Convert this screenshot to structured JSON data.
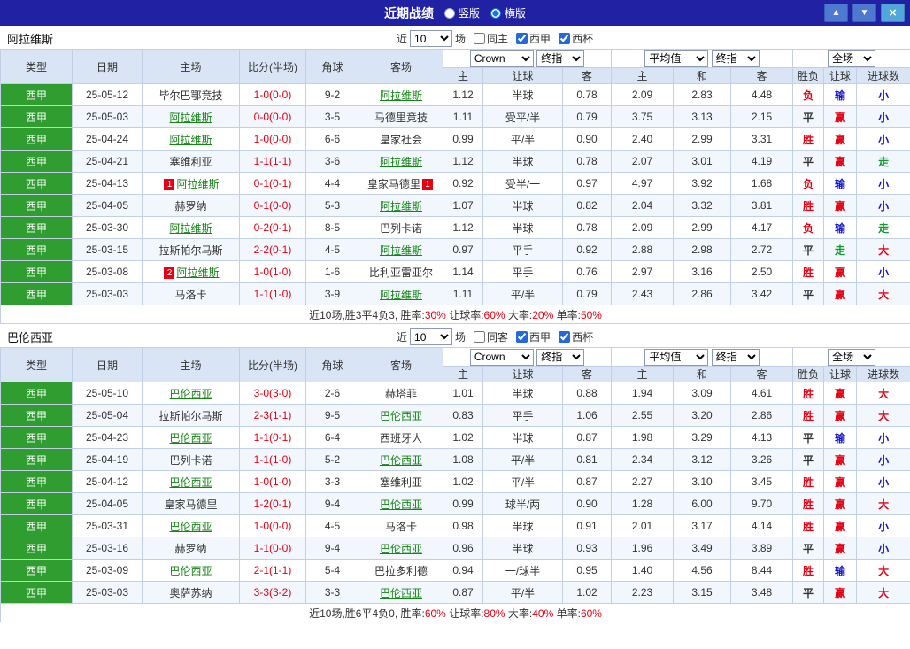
{
  "topbar": {
    "title": "近期战绩",
    "radios": [
      {
        "label": "竖版",
        "selected": false
      },
      {
        "label": "横版",
        "selected": true
      }
    ],
    "icons": {
      "up": "▲",
      "down": "▼",
      "close": "×"
    }
  },
  "colors": {
    "accent_green": "#2f9d2f",
    "win_red": "#e60012",
    "lose_blue": "#1414c8",
    "push_green": "#0f9a30",
    "header_blue": "#d9e5f4",
    "topbar_blue": "#2121a3"
  },
  "columns": [
    "类型",
    "日期",
    "主场",
    "比分(半场)",
    "角球",
    "客场",
    "主",
    "让球",
    "客",
    "主",
    "和",
    "客",
    "胜负",
    "让球",
    "进球数"
  ],
  "sections": [
    {
      "team": "阿拉维斯",
      "near_label": "近",
      "games_count": "10",
      "games_unit": "场",
      "checkboxes": [
        {
          "label": "同主",
          "checked": false
        },
        {
          "label": "西甲",
          "checked": true
        },
        {
          "label": "西杯",
          "checked": true
        }
      ],
      "filters": {
        "bookmaker": "Crown",
        "asia_stage": "终指",
        "euro_source": "平均值",
        "euro_stage": "终指",
        "scope": "全场"
      },
      "rows": [
        {
          "league": "西甲",
          "date": "25-05-12",
          "home": "毕尔巴鄂竞技",
          "home_focus": false,
          "score": "1-0(0-0)",
          "corner": "9-2",
          "away": "阿拉维斯",
          "away_focus": true,
          "asia_home": "1.12",
          "asia_line": "半球",
          "asia_away": "0.78",
          "euro_home": "2.09",
          "euro_draw": "2.83",
          "euro_away": "4.48",
          "result": "负",
          "handicap_result": "输",
          "goals": "小"
        },
        {
          "league": "西甲",
          "date": "25-05-03",
          "home": "阿拉维斯",
          "home_focus": true,
          "score": "0-0(0-0)",
          "corner": "3-5",
          "away": "马德里竞技",
          "away_focus": false,
          "asia_home": "1.11",
          "asia_line": "受平/半",
          "asia_away": "0.79",
          "euro_home": "3.75",
          "euro_draw": "3.13",
          "euro_away": "2.15",
          "result": "平",
          "handicap_result": "赢",
          "goals": "小"
        },
        {
          "league": "西甲",
          "date": "25-04-24",
          "home": "阿拉维斯",
          "home_focus": true,
          "score": "1-0(0-0)",
          "corner": "6-6",
          "away": "皇家社会",
          "away_focus": false,
          "asia_home": "0.99",
          "asia_line": "平/半",
          "asia_away": "0.90",
          "euro_home": "2.40",
          "euro_draw": "2.99",
          "euro_away": "3.31",
          "result": "胜",
          "handicap_result": "赢",
          "goals": "小"
        },
        {
          "league": "西甲",
          "date": "25-04-21",
          "home": "塞维利亚",
          "home_focus": false,
          "score": "1-1(1-1)",
          "corner": "3-6",
          "away": "阿拉维斯",
          "away_focus": true,
          "asia_home": "1.12",
          "asia_line": "半球",
          "asia_away": "0.78",
          "euro_home": "2.07",
          "euro_draw": "3.01",
          "euro_away": "4.19",
          "result": "平",
          "handicap_result": "赢",
          "goals": "走"
        },
        {
          "league": "西甲",
          "date": "25-04-13",
          "home": "阿拉维斯",
          "home_focus": true,
          "home_badge": "1",
          "score": "0-1(0-1)",
          "corner": "4-4",
          "away": "皇家马德里",
          "away_focus": false,
          "away_badge": "1",
          "asia_home": "0.92",
          "asia_line": "受半/一",
          "asia_away": "0.97",
          "euro_home": "4.97",
          "euro_draw": "3.92",
          "euro_away": "1.68",
          "result": "负",
          "handicap_result": "输",
          "goals": "小"
        },
        {
          "league": "西甲",
          "date": "25-04-05",
          "home": "赫罗纳",
          "home_focus": false,
          "score": "0-1(0-0)",
          "corner": "5-3",
          "away": "阿拉维斯",
          "away_focus": true,
          "asia_home": "1.07",
          "asia_line": "半球",
          "asia_away": "0.82",
          "euro_home": "2.04",
          "euro_draw": "3.32",
          "euro_away": "3.81",
          "result": "胜",
          "handicap_result": "赢",
          "goals": "小"
        },
        {
          "league": "西甲",
          "date": "25-03-30",
          "home": "阿拉维斯",
          "home_focus": true,
          "score": "0-2(0-1)",
          "corner": "8-5",
          "away": "巴列卡诺",
          "away_focus": false,
          "asia_home": "1.12",
          "asia_line": "半球",
          "asia_away": "0.78",
          "euro_home": "2.09",
          "euro_draw": "2.99",
          "euro_away": "4.17",
          "result": "负",
          "handicap_result": "输",
          "goals": "走"
        },
        {
          "league": "西甲",
          "date": "25-03-15",
          "home": "拉斯帕尔马斯",
          "home_focus": false,
          "score": "2-2(0-1)",
          "corner": "4-5",
          "away": "阿拉维斯",
          "away_focus": true,
          "asia_home": "0.97",
          "asia_line": "平手",
          "asia_away": "0.92",
          "euro_home": "2.88",
          "euro_draw": "2.98",
          "euro_away": "2.72",
          "result": "平",
          "handicap_result": "走",
          "goals": "大"
        },
        {
          "league": "西甲",
          "date": "25-03-08",
          "home": "阿拉维斯",
          "home_focus": true,
          "home_badge": "2",
          "score": "1-0(1-0)",
          "corner": "1-6",
          "away": "比利亚雷亚尔",
          "away_focus": false,
          "asia_home": "1.14",
          "asia_line": "平手",
          "asia_away": "0.76",
          "euro_home": "2.97",
          "euro_draw": "3.16",
          "euro_away": "2.50",
          "result": "胜",
          "handicap_result": "赢",
          "goals": "小"
        },
        {
          "league": "西甲",
          "date": "25-03-03",
          "home": "马洛卡",
          "home_focus": false,
          "score": "1-1(1-0)",
          "corner": "3-9",
          "away": "阿拉维斯",
          "away_focus": true,
          "asia_home": "1.11",
          "asia_line": "平/半",
          "asia_away": "0.79",
          "euro_home": "2.43",
          "euro_draw": "2.86",
          "euro_away": "3.42",
          "result": "平",
          "handicap_result": "赢",
          "goals": "大"
        }
      ],
      "summary": {
        "prefix": "近10场,胜3平4负3,",
        "stats": [
          {
            "label": "胜率:",
            "value": "30%"
          },
          {
            "label": "让球率:",
            "value": "60%"
          },
          {
            "label": "大率:",
            "value": "20%"
          },
          {
            "label": "单率:",
            "value": "50%"
          }
        ]
      }
    },
    {
      "team": "巴伦西亚",
      "near_label": "近",
      "games_count": "10",
      "games_unit": "场",
      "checkboxes": [
        {
          "label": "同客",
          "checked": false
        },
        {
          "label": "西甲",
          "checked": true
        },
        {
          "label": "西杯",
          "checked": true
        }
      ],
      "filters": {
        "bookmaker": "Crown",
        "asia_stage": "终指",
        "euro_source": "平均值",
        "euro_stage": "终指",
        "scope": "全场"
      },
      "rows": [
        {
          "league": "西甲",
          "date": "25-05-10",
          "home": "巴伦西亚",
          "home_focus": true,
          "score": "3-0(3-0)",
          "corner": "2-6",
          "away": "赫塔菲",
          "away_focus": false,
          "asia_home": "1.01",
          "asia_line": "半球",
          "asia_away": "0.88",
          "euro_home": "1.94",
          "euro_draw": "3.09",
          "euro_away": "4.61",
          "result": "胜",
          "handicap_result": "赢",
          "goals": "大"
        },
        {
          "league": "西甲",
          "date": "25-05-04",
          "home": "拉斯帕尔马斯",
          "home_focus": false,
          "score": "2-3(1-1)",
          "corner": "9-5",
          "away": "巴伦西亚",
          "away_focus": true,
          "asia_home": "0.83",
          "asia_line": "平手",
          "asia_away": "1.06",
          "euro_home": "2.55",
          "euro_draw": "3.20",
          "euro_away": "2.86",
          "result": "胜",
          "handicap_result": "赢",
          "goals": "大"
        },
        {
          "league": "西甲",
          "date": "25-04-23",
          "home": "巴伦西亚",
          "home_focus": true,
          "score": "1-1(0-1)",
          "corner": "6-4",
          "away": "西班牙人",
          "away_focus": false,
          "asia_home": "1.02",
          "asia_line": "半球",
          "asia_away": "0.87",
          "euro_home": "1.98",
          "euro_draw": "3.29",
          "euro_away": "4.13",
          "result": "平",
          "handicap_result": "输",
          "goals": "小"
        },
        {
          "league": "西甲",
          "date": "25-04-19",
          "home": "巴列卡诺",
          "home_focus": false,
          "score": "1-1(1-0)",
          "corner": "5-2",
          "away": "巴伦西亚",
          "away_focus": true,
          "asia_home": "1.08",
          "asia_line": "平/半",
          "asia_away": "0.81",
          "euro_home": "2.34",
          "euro_draw": "3.12",
          "euro_away": "3.26",
          "result": "平",
          "handicap_result": "赢",
          "goals": "小"
        },
        {
          "league": "西甲",
          "date": "25-04-12",
          "home": "巴伦西亚",
          "home_focus": true,
          "score": "1-0(1-0)",
          "corner": "3-3",
          "away": "塞维利亚",
          "away_focus": false,
          "asia_home": "1.02",
          "asia_line": "平/半",
          "asia_away": "0.87",
          "euro_home": "2.27",
          "euro_draw": "3.10",
          "euro_away": "3.45",
          "result": "胜",
          "handicap_result": "赢",
          "goals": "小"
        },
        {
          "league": "西甲",
          "date": "25-04-05",
          "home": "皇家马德里",
          "home_focus": false,
          "score": "1-2(0-1)",
          "corner": "9-4",
          "away": "巴伦西亚",
          "away_focus": true,
          "asia_home": "0.99",
          "asia_line": "球半/两",
          "asia_away": "0.90",
          "euro_home": "1.28",
          "euro_draw": "6.00",
          "euro_away": "9.70",
          "result": "胜",
          "handicap_result": "赢",
          "goals": "大"
        },
        {
          "league": "西甲",
          "date": "25-03-31",
          "home": "巴伦西亚",
          "home_focus": true,
          "score": "1-0(0-0)",
          "corner": "4-5",
          "away": "马洛卡",
          "away_focus": false,
          "asia_home": "0.98",
          "asia_line": "半球",
          "asia_away": "0.91",
          "euro_home": "2.01",
          "euro_draw": "3.17",
          "euro_away": "4.14",
          "result": "胜",
          "handicap_result": "赢",
          "goals": "小"
        },
        {
          "league": "西甲",
          "date": "25-03-16",
          "home": "赫罗纳",
          "home_focus": false,
          "score": "1-1(0-0)",
          "corner": "9-4",
          "away": "巴伦西亚",
          "away_focus": true,
          "asia_home": "0.96",
          "asia_line": "半球",
          "asia_away": "0.93",
          "euro_home": "1.96",
          "euro_draw": "3.49",
          "euro_away": "3.89",
          "result": "平",
          "handicap_result": "赢",
          "goals": "小"
        },
        {
          "league": "西甲",
          "date": "25-03-09",
          "home": "巴伦西亚",
          "home_focus": true,
          "score": "2-1(1-1)",
          "corner": "5-4",
          "away": "巴拉多利德",
          "away_focus": false,
          "asia_home": "0.94",
          "asia_line": "一/球半",
          "asia_away": "0.95",
          "euro_home": "1.40",
          "euro_draw": "4.56",
          "euro_away": "8.44",
          "result": "胜",
          "handicap_result": "输",
          "goals": "大"
        },
        {
          "league": "西甲",
          "date": "25-03-03",
          "home": "奥萨苏纳",
          "home_focus": false,
          "score": "3-3(3-2)",
          "corner": "3-3",
          "away": "巴伦西亚",
          "away_focus": true,
          "asia_home": "0.87",
          "asia_line": "平/半",
          "asia_away": "1.02",
          "euro_home": "2.23",
          "euro_draw": "3.15",
          "euro_away": "3.48",
          "result": "平",
          "handicap_result": "赢",
          "goals": "大"
        }
      ],
      "summary": {
        "prefix": "近10场,胜6平4负0,",
        "stats": [
          {
            "label": "胜率:",
            "value": "60%"
          },
          {
            "label": "让球率:",
            "value": "80%"
          },
          {
            "label": "大率:",
            "value": "40%"
          },
          {
            "label": "单率:",
            "value": "60%"
          }
        ]
      }
    }
  ]
}
